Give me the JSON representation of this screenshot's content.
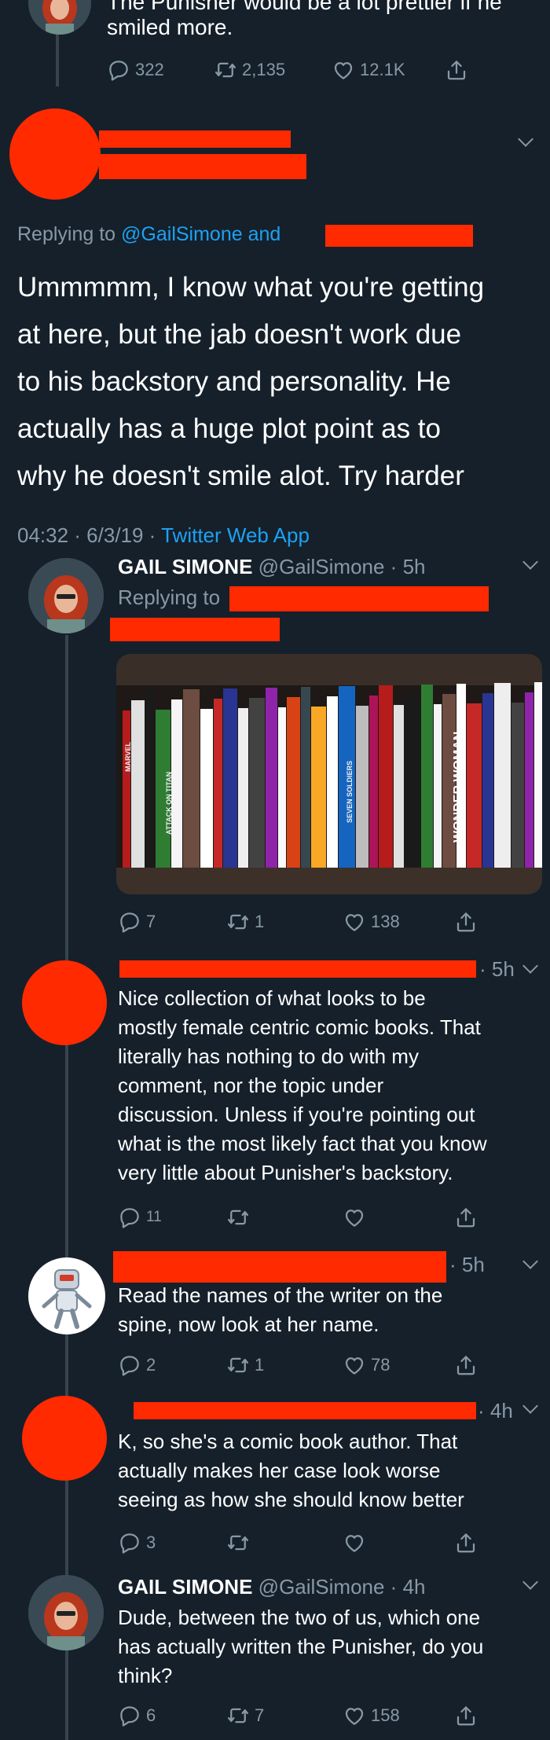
{
  "tweet0": {
    "text_line1": "The Punisher would be a lot prettier if he",
    "text_line2": "smiled more.",
    "replies": "322",
    "retweets": "2,135",
    "likes": "12.1K"
  },
  "main": {
    "replying_prefix": "Replying to ",
    "replying_handle": "@GailSimone",
    "replying_and": " and",
    "body_lines": [
      "Ummmmm, I know what you're getting",
      "at here, but the jab doesn't work due",
      "to his backstory and personality. He",
      "actually has a huge plot point as to",
      "why he doesn't smile alot. Try harder"
    ],
    "time": "04:32 · 6/3/19 · ",
    "source": "Twitter Web App"
  },
  "reply1": {
    "name": "GAIL SIMONE",
    "handle": "@GailSimone · 5h",
    "replying_to": "Replying to",
    "replies": "7",
    "retweets": "1",
    "likes": "138"
  },
  "reply2": {
    "time": "· 5h",
    "body_lines": [
      "Nice collection of what looks to be",
      "mostly female centric comic books. That",
      "literally has nothing to do with my",
      "comment, nor the topic under",
      "discussion. Unless if you're pointing out",
      "what is the most likely fact that you know",
      "very little about Punisher's backstory."
    ],
    "replies": "11",
    "retweets": "",
    "likes": ""
  },
  "reply3": {
    "time": "· 5h",
    "body_lines": [
      "Read the names of the writer on the",
      "spine, now look at her name."
    ],
    "replies": "2",
    "retweets": "1",
    "likes": "78"
  },
  "reply4": {
    "time": "· 4h",
    "body_lines": [
      "K, so she's a comic book author. That",
      "actually makes her case look worse",
      "seeing as how she should know better"
    ],
    "replies": "3",
    "retweets": "",
    "likes": ""
  },
  "reply5": {
    "name": "GAIL SIMONE",
    "handle": "@GailSimone · 4h",
    "body_lines": [
      "Dude, between the two of us, which one",
      "has actually written the Punisher, do you",
      "think?"
    ],
    "replies": "6",
    "retweets": "7",
    "likes": "158"
  },
  "book_spines": [
    "MARVEL",
    "ATTACK ON TITAN",
    "SEVEN SOLDIERS",
    "WONDER WOMAN"
  ],
  "colors": {
    "background": "#15202b",
    "text": "#ffffff",
    "secondary": "#8899a6",
    "link": "#1da1f2",
    "redaction": "#ff2a00",
    "thread_line": "#38444d"
  },
  "icons": [
    "reply-icon",
    "retweet-icon",
    "like-icon",
    "share-icon",
    "chevron-down-icon"
  ]
}
